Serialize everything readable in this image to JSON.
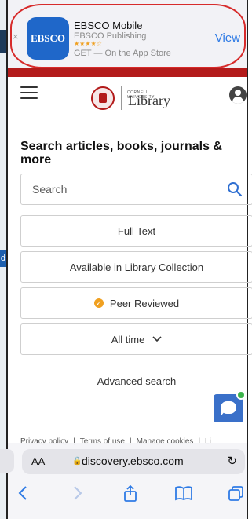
{
  "banner": {
    "close": "×",
    "icon_text": "EBSCO",
    "app_name": "EBSCO Mobile",
    "publisher": "EBSCO Publishing",
    "stars": "★★★★☆",
    "get_text": "GET — On the App Store",
    "view_label": "View"
  },
  "header": {
    "logo_small": "CORNELL UNIVERSITY",
    "logo_text": "Library"
  },
  "search": {
    "heading": "Search articles, books, journals & more",
    "placeholder": "Search"
  },
  "filters": {
    "full_text": "Full Text",
    "library_collection": "Available in Library Collection",
    "peer_reviewed": "Peer Reviewed",
    "peer_check": "✓",
    "date_range": "All time"
  },
  "advanced_search": "Advanced search",
  "footer": {
    "links": [
      "Privacy policy",
      "|",
      "Terms of use",
      "|",
      "Manage cookies",
      "|",
      "Li"
    ]
  },
  "browser": {
    "text_size": "AA",
    "lock": "🔒",
    "url": "discovery.ebsco.com",
    "reload": "↻"
  },
  "left_bleed": {
    "label": "d"
  },
  "colors": {
    "accent": "#2f7be5",
    "brand_red": "#b31b1b",
    "peer_badge": "#f0a020",
    "chat": "#3a70c9"
  }
}
